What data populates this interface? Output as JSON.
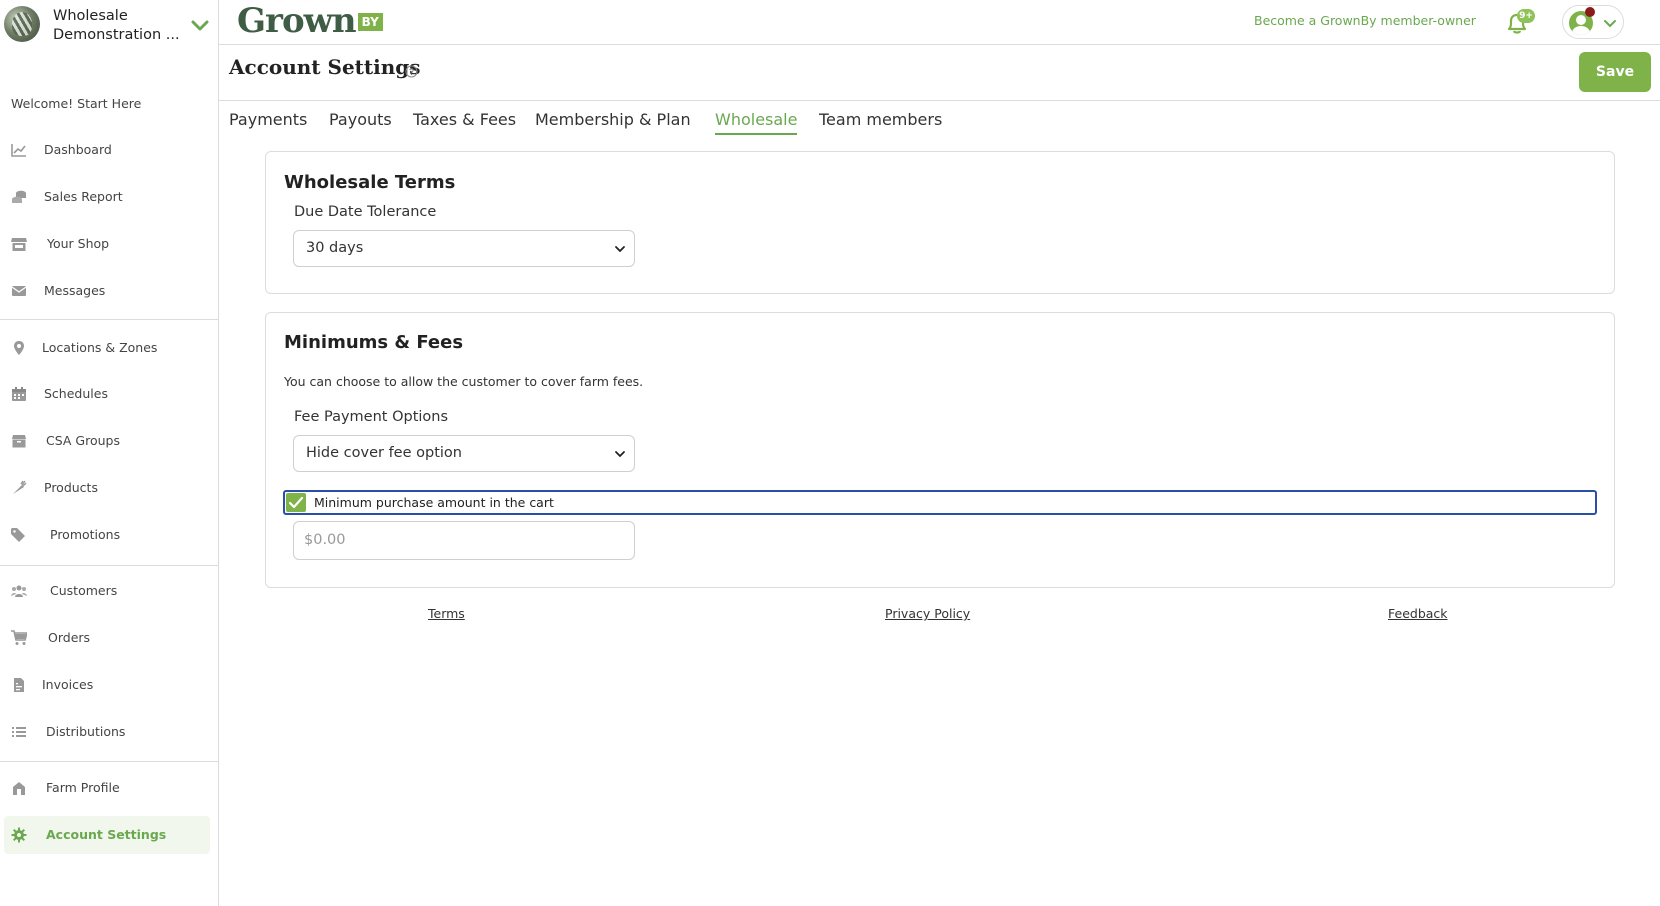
{
  "farm": {
    "name": "Wholesale Demonstration ..."
  },
  "sidebar": {
    "welcome": "Welcome! Start Here",
    "items": [
      {
        "label": "Dashboard",
        "icon": "chart-line-icon"
      },
      {
        "label": "Sales Report",
        "icon": "coins-icon"
      },
      {
        "label": "Your Shop",
        "icon": "store-icon"
      },
      {
        "label": "Messages",
        "icon": "envelope-icon"
      },
      {
        "label": "Locations & Zones",
        "icon": "map-pin-icon"
      },
      {
        "label": "Schedules",
        "icon": "calendar-icon"
      },
      {
        "label": "CSA Groups",
        "icon": "box-icon"
      },
      {
        "label": "Products",
        "icon": "carrot-icon"
      },
      {
        "label": "Promotions",
        "icon": "tags-icon"
      },
      {
        "label": "Customers",
        "icon": "users-icon"
      },
      {
        "label": "Orders",
        "icon": "cart-icon"
      },
      {
        "label": "Invoices",
        "icon": "file-invoice-icon"
      },
      {
        "label": "Distributions",
        "icon": "list-icon"
      },
      {
        "label": "Farm Profile",
        "icon": "farm-icon"
      },
      {
        "label": "Account Settings",
        "icon": "gear-icon"
      }
    ],
    "active": "Account Settings"
  },
  "topbar": {
    "logo_word": "Grown",
    "logo_by": "BY",
    "member_link": "Become a GrownBy member-owner",
    "notification_badge": "9+"
  },
  "page": {
    "title": "Account Settings",
    "save_label": "Save"
  },
  "tabs": [
    {
      "label": "Payments"
    },
    {
      "label": "Payouts"
    },
    {
      "label": "Taxes & Fees"
    },
    {
      "label": "Membership & Plan"
    },
    {
      "label": "Wholesale"
    },
    {
      "label": "Team members"
    }
  ],
  "active_tab": "Wholesale",
  "wholesale_terms": {
    "title": "Wholesale Terms",
    "due_date_label": "Due Date Tolerance",
    "due_date_value": "30 days"
  },
  "minimums_fees": {
    "title": "Minimums & Fees",
    "description": "You can choose to allow the customer to cover farm fees.",
    "fee_label": "Fee Payment Options",
    "fee_value": "Hide cover fee option",
    "min_checkbox_label": "Minimum purchase amount in the cart",
    "min_checkbox_checked": true,
    "min_amount_placeholder": "$0.00"
  },
  "footer": {
    "terms": "Terms",
    "privacy": "Privacy Policy",
    "feedback": "Feedback"
  },
  "colors": {
    "brand_green": "#7fb34a",
    "link_green": "#6aa84f",
    "logo_dark": "#3f5d44",
    "focus_blue": "#2a4fa8"
  }
}
